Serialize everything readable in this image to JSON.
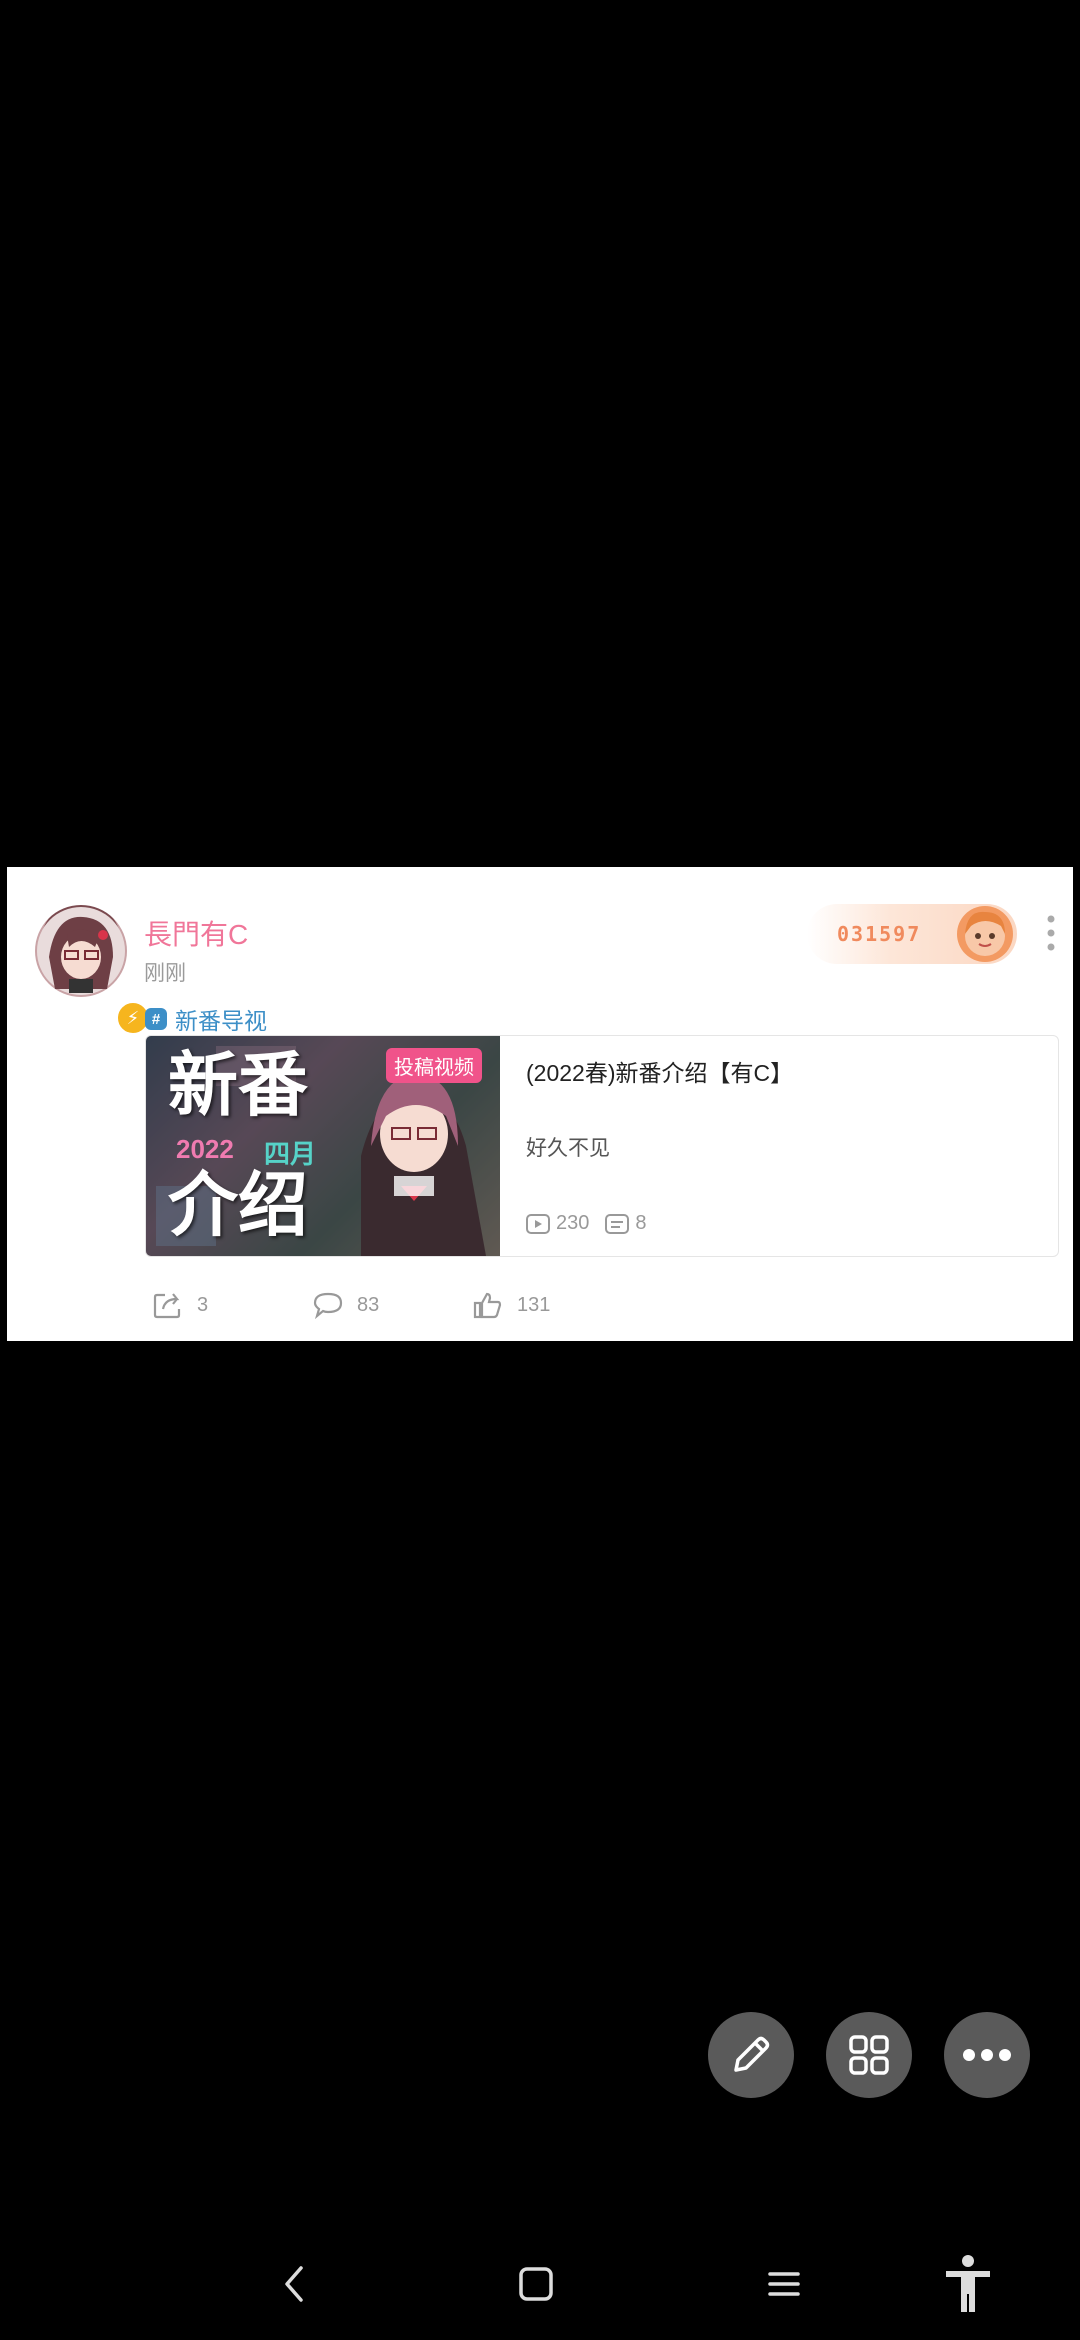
{
  "post": {
    "username": "長門有C",
    "time": "刚刚",
    "fan_number": "031597",
    "topic": "新番导视",
    "topic_icon": "hash-icon",
    "video": {
      "cover_big_line1": "新番",
      "cover_big_line2": "介绍",
      "cover_year": "2022",
      "cover_month": "四月",
      "cover_tag": "投稿视频",
      "title": "(2022春)新番介绍【有C】",
      "description": "好久不见",
      "plays": "230",
      "danmaku": "8"
    },
    "actions": {
      "share": "3",
      "comments": "83",
      "likes": "131"
    }
  },
  "colors": {
    "username": "#f07699",
    "topic": "#3d8fc7",
    "fab": "#5a5a5a",
    "cover_tag": "#f0538a"
  },
  "fabs": [
    "edit-icon",
    "grid-icon",
    "more-icon"
  ],
  "nav": [
    "back-icon",
    "home-icon",
    "recents-icon",
    "accessibility-icon"
  ]
}
